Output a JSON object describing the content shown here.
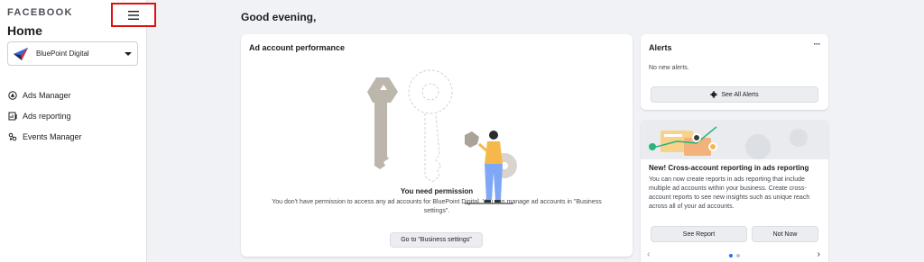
{
  "sidebar": {
    "brand": "FACEBOOK",
    "home_title": "Home",
    "account_name": "BluePoint Digital",
    "nav": [
      {
        "label": "Ads Manager",
        "icon": "ads-manager-icon"
      },
      {
        "label": "Ads reporting",
        "icon": "ads-reporting-icon"
      },
      {
        "label": "Events Manager",
        "icon": "events-manager-icon"
      }
    ]
  },
  "main": {
    "greeting": "Good evening,"
  },
  "performance": {
    "title": "Ad account performance",
    "heading": "You need permission",
    "description": "You don't have permission to access any ad accounts for BluePoint Digital. You can manage ad accounts in \"Business settings\".",
    "button": "Go to \"Business settings\""
  },
  "alerts": {
    "title": "Alerts",
    "more": "···",
    "empty": "No new alerts.",
    "button": "See All Alerts"
  },
  "promo": {
    "title": "New! Cross-account reporting in ads reporting",
    "text": "You can now create reports in ads reporting that include multiple ad accounts within your business. Create cross-account reports to see new insights such as unique reach across all of your ad accounts.",
    "primary": "See Report",
    "secondary": "Not Now",
    "prev": "‹",
    "next": "›"
  },
  "colors": {
    "accent": "#1877f2",
    "highlight_border": "#e01010",
    "figure_top": "#f7b84b",
    "figure_pants": "#7fa7f5"
  }
}
